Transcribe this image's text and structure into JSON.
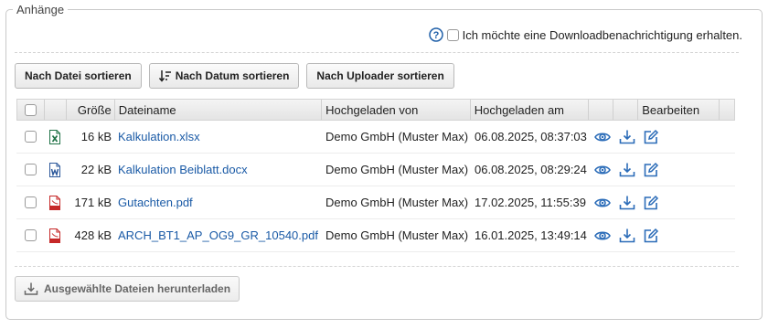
{
  "section": {
    "legend": "Anhänge"
  },
  "notify": {
    "label": "Ich möchte eine Downloadbenachrichtigung erhalten.",
    "checked": false
  },
  "sort_buttons": {
    "by_file": "Nach Datei sortieren",
    "by_date": "Nach Datum sortieren",
    "by_uploader": "Nach Uploader sortieren"
  },
  "table": {
    "headers": {
      "size": "Größe",
      "filename": "Dateiname",
      "uploaded_by": "Hochgeladen von",
      "uploaded_at": "Hochgeladen am",
      "edit": "Bearbeiten"
    },
    "rows": [
      {
        "file_type": "xlsx",
        "icon": "excel-file-icon",
        "size": "16 kB",
        "filename": "Kalkulation.xlsx",
        "uploaded_by": "Demo GmbH (Muster Max)",
        "uploaded_at": "06.08.2025, 08:37:03"
      },
      {
        "file_type": "docx",
        "icon": "word-file-icon",
        "size": "22 kB",
        "filename": "Kalkulation Beiblatt.docx",
        "uploaded_by": "Demo GmbH (Muster Max)",
        "uploaded_at": "06.08.2025, 08:29:24"
      },
      {
        "file_type": "pdf",
        "icon": "pdf-file-icon",
        "size": "171 kB",
        "filename": "Gutachten.pdf",
        "uploaded_by": "Demo GmbH (Muster Max)",
        "uploaded_at": "17.02.2025, 11:55:39"
      },
      {
        "file_type": "pdf",
        "icon": "pdf-file-icon",
        "size": "428 kB",
        "filename": "ARCH_BT1_AP_OG9_GR_10540.pdf",
        "uploaded_by": "Demo GmbH (Muster Max)",
        "uploaded_at": "16.01.2025, 13:49:14"
      }
    ]
  },
  "download_selected": {
    "label": "Ausgewählte Dateien herunterladen"
  },
  "colors": {
    "link": "#1a5aa6",
    "icon_blue": "#2b6cb8",
    "excel": "#1e7145",
    "word": "#2b579a",
    "pdf": "#c62828"
  }
}
